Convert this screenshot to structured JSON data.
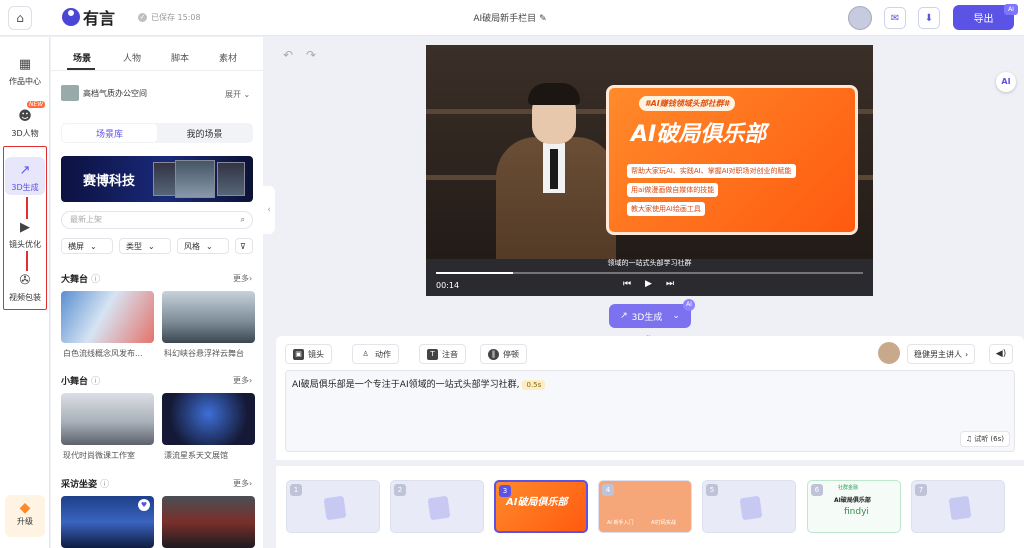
{
  "topbar": {
    "logo_text": "有言",
    "saved_text": "已保存 15:08",
    "project_title": "AI破局新手栏目",
    "export_label": "导出",
    "badge_ai": "AI"
  },
  "leftnav": {
    "items": [
      {
        "label": "作品中心",
        "icon": "grid-icon"
      },
      {
        "label": "3D人物",
        "icon": "avatar-icon",
        "badge": "NEW"
      },
      {
        "label": "3D生成",
        "icon": "chart-icon"
      },
      {
        "label": "镜头优化",
        "icon": "camera-icon"
      },
      {
        "label": "视频包装",
        "icon": "film-reel-icon"
      }
    ],
    "upgrade_label": "升级"
  },
  "panel": {
    "tabs": [
      "场景",
      "人物",
      "脚本",
      "素材"
    ],
    "room_name": "高档气质办公空间",
    "expand_label": "展开",
    "segments": [
      "场景库",
      "我的场景"
    ],
    "banner_text": "赛博科技",
    "search_placeholder": "最新上架",
    "filters": [
      "横屏",
      "类型",
      "风格"
    ],
    "sections": [
      {
        "title": "大舞台",
        "more": "更多",
        "items": [
          "白色流线概念风发布...",
          "科幻峡谷悬浮祥云舞台"
        ]
      },
      {
        "title": "小舞台",
        "more": "更多",
        "items": [
          "现代时尚微课工作室",
          "漂流星系天文展馆"
        ]
      },
      {
        "title": "采访坐姿",
        "more": "更多",
        "items": []
      }
    ]
  },
  "video": {
    "card_tag": "#AI赚钱领域头部社群#",
    "card_title": "AI破局俱乐部",
    "card_lines": [
      "帮助大家玩AI、实践AI、掌握AI对职场对创业的赋能",
      "用ai做漫画做自媒体的技能",
      "教大家使用AI绘画工具"
    ],
    "subtitle": "领域的一站式头部学习社群",
    "time": "00:14",
    "progress": 0.18
  },
  "generate_label": "3D生成",
  "editor": {
    "toolbar": [
      "镜头",
      "动作",
      "注音",
      "停顿"
    ],
    "speaker_label": "稳健男主讲人",
    "script_text": "AI破局俱乐部是一个专注于AI领域的一站式头部学习社群,",
    "pause_chip": "0.5s",
    "preview_label": "试听 (6s)"
  },
  "storyboard": {
    "frames": [
      "1",
      "2",
      "3",
      "4",
      "5",
      "6",
      "7"
    ],
    "selected": "3",
    "frame3_title": "AI破局俱乐部",
    "frame4_labels": [
      "AI 新手入门",
      "AI打码实战"
    ],
    "frame6_tag": "社群金融",
    "frame6_title": "AI破局俱乐部",
    "frame6_name": "findyi"
  },
  "colors": {
    "accent": "#5b53e6",
    "annotation_red": "#e03030",
    "card_orange": "#ff6a18"
  }
}
